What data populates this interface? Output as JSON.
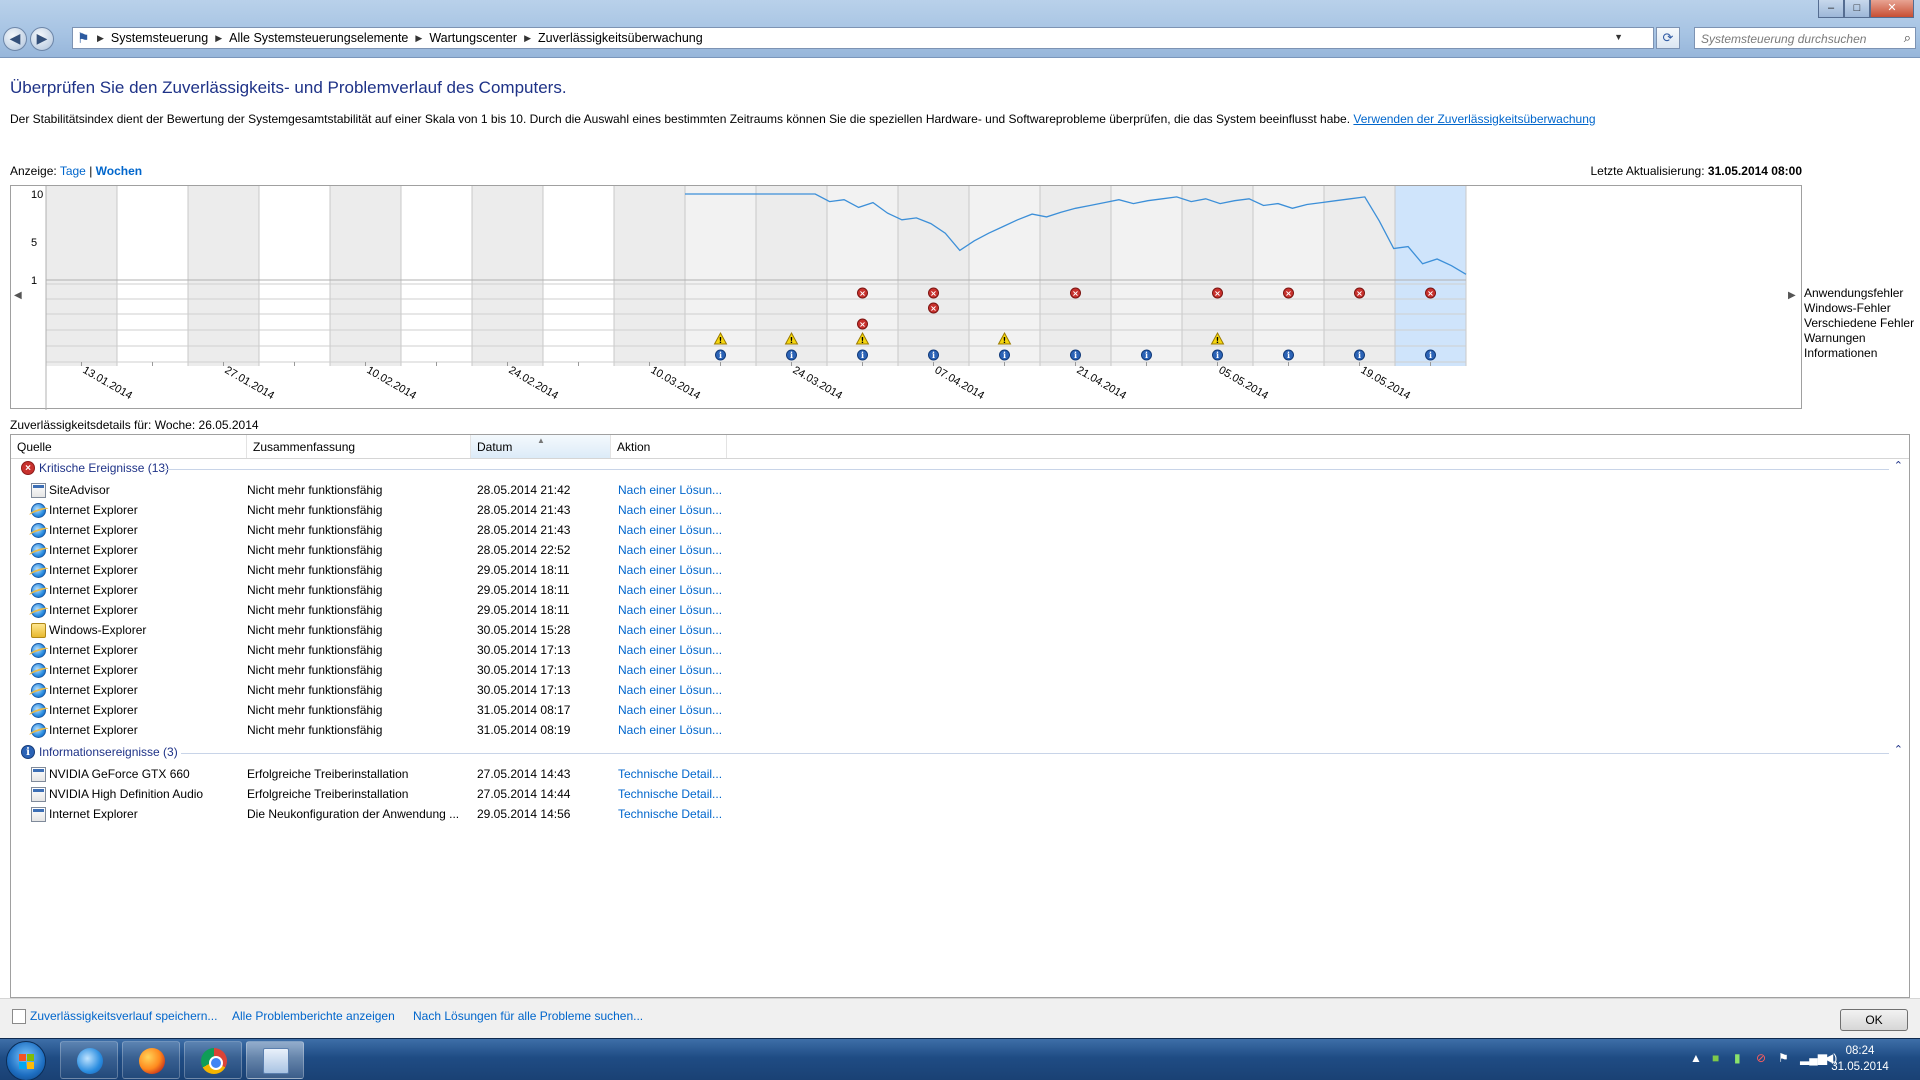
{
  "window": {
    "breadcrumb": [
      "Systemsteuerung",
      "Alle Systemsteuerungselemente",
      "Wartungscenter",
      "Zuverlässigkeitsüberwachung"
    ],
    "search_placeholder": "Systemsteuerung durchsuchen",
    "controls": {
      "minimize": "–",
      "maximize": "□",
      "close": "✕"
    }
  },
  "header": {
    "title": "Überprüfen Sie den Zuverlässigkeits- und Problemverlauf des Computers.",
    "intro": "Der Stabilitätsindex dient der Bewertung der Systemgesamtstabilität auf einer Skala von 1 bis 10. Durch die Auswahl eines bestimmten Zeitraums können Sie die speziellen Hardware- und Softwareprobleme überprüfen, die das System beeinflusst habe.",
    "intro_link": "Verwenden der Zuverlässigkeitsüberwachung",
    "view_label": "Anzeige:",
    "view_days": "Tage",
    "view_sep": "|",
    "view_weeks": "Wochen",
    "last_update_label": "Letzte Aktualisierung:",
    "last_update_value": "31.05.2014 08:00"
  },
  "chart_data": {
    "type": "line",
    "ylim": [
      1,
      10
    ],
    "yticks": [
      "10",
      "5",
      "1"
    ],
    "columns": 20,
    "selected_column": 19,
    "x_labels": [
      "13.01.2014",
      "27.01.2014",
      "10.02.2014",
      "24.02.2014",
      "10.03.2014",
      "24.03.2014",
      "07.04.2014",
      "21.04.2014",
      "05.05.2014",
      "19.05.2014"
    ],
    "stability_index": [
      10,
      10,
      10,
      10,
      10,
      10,
      10,
      10.0,
      10,
      10,
      9.2,
      9.4,
      8.6,
      9.1,
      8.0,
      7.3,
      7.5,
      6.9,
      5.9,
      4.1,
      5.1,
      5.9,
      6.6,
      7.3,
      7.9,
      7.6,
      8.1,
      8.5,
      8.8,
      9.1,
      9.4,
      9.0,
      9.3,
      9.5,
      9.7,
      9.2,
      9.5,
      9.0,
      9.3,
      9.5,
      8.8,
      9.0,
      8.5,
      8.9,
      9.1,
      9.3,
      9.5,
      9.7,
      7.2,
      4.3,
      4.5,
      2.7,
      3.2,
      2.5,
      1.6
    ],
    "legend": [
      "Anwendungsfehler",
      "Windows-Fehler",
      "Verschiedene Fehler",
      "Warnungen",
      "Informationen"
    ],
    "events": {
      "app_errors": [
        11,
        12,
        14,
        16,
        17,
        18,
        19
      ],
      "windows_errors": [
        12
      ],
      "misc_errors": [
        11
      ],
      "warnings": [
        9,
        10,
        11,
        13,
        16
      ],
      "informations": [
        9,
        10,
        11,
        12,
        13,
        14,
        15,
        16,
        17,
        18,
        19
      ]
    }
  },
  "details": {
    "label": "Zuverlässigkeitsdetails für: Woche: 26.05.2014",
    "columns": [
      "Quelle",
      "Zusammenfassung",
      "Datum",
      "Aktion"
    ],
    "groups": [
      {
        "title": "Kritische Ereignisse (13)",
        "icon": "error-icon",
        "rows": [
          {
            "icon": "window-icon",
            "source": "SiteAdvisor",
            "summary": "Nicht mehr funktionsfähig",
            "date": "28.05.2014 21:42",
            "action": "Nach einer Lösun..."
          },
          {
            "icon": "ie-icon",
            "source": "Internet Explorer",
            "summary": "Nicht mehr funktionsfähig",
            "date": "28.05.2014 21:43",
            "action": "Nach einer Lösun..."
          },
          {
            "icon": "ie-icon",
            "source": "Internet Explorer",
            "summary": "Nicht mehr funktionsfähig",
            "date": "28.05.2014 21:43",
            "action": "Nach einer Lösun..."
          },
          {
            "icon": "ie-icon",
            "source": "Internet Explorer",
            "summary": "Nicht mehr funktionsfähig",
            "date": "28.05.2014 22:52",
            "action": "Nach einer Lösun..."
          },
          {
            "icon": "ie-icon",
            "source": "Internet Explorer",
            "summary": "Nicht mehr funktionsfähig",
            "date": "29.05.2014 18:11",
            "action": "Nach einer Lösun..."
          },
          {
            "icon": "ie-icon",
            "source": "Internet Explorer",
            "summary": "Nicht mehr funktionsfähig",
            "date": "29.05.2014 18:11",
            "action": "Nach einer Lösun..."
          },
          {
            "icon": "ie-icon",
            "source": "Internet Explorer",
            "summary": "Nicht mehr funktionsfähig",
            "date": "29.05.2014 18:11",
            "action": "Nach einer Lösun..."
          },
          {
            "icon": "folder-icon",
            "source": "Windows-Explorer",
            "summary": "Nicht mehr funktionsfähig",
            "date": "30.05.2014 15:28",
            "action": "Nach einer Lösun..."
          },
          {
            "icon": "ie-icon",
            "source": "Internet Explorer",
            "summary": "Nicht mehr funktionsfähig",
            "date": "30.05.2014 17:13",
            "action": "Nach einer Lösun..."
          },
          {
            "icon": "ie-icon",
            "source": "Internet Explorer",
            "summary": "Nicht mehr funktionsfähig",
            "date": "30.05.2014 17:13",
            "action": "Nach einer Lösun..."
          },
          {
            "icon": "ie-icon",
            "source": "Internet Explorer",
            "summary": "Nicht mehr funktionsfähig",
            "date": "30.05.2014 17:13",
            "action": "Nach einer Lösun..."
          },
          {
            "icon": "ie-icon",
            "source": "Internet Explorer",
            "summary": "Nicht mehr funktionsfähig",
            "date": "31.05.2014 08:17",
            "action": "Nach einer Lösun..."
          },
          {
            "icon": "ie-icon",
            "source": "Internet Explorer",
            "summary": "Nicht mehr funktionsfähig",
            "date": "31.05.2014 08:19",
            "action": "Nach einer Lösun..."
          }
        ]
      },
      {
        "title": "Informationsereignisse (3)",
        "icon": "info-icon",
        "rows": [
          {
            "icon": "window-icon",
            "source": "NVIDIA GeForce GTX 660",
            "summary": "Erfolgreiche Treiberinstallation",
            "date": "27.05.2014 14:43",
            "action": "Technische Detail..."
          },
          {
            "icon": "window-icon",
            "source": "NVIDIA High Definition Audio",
            "summary": "Erfolgreiche Treiberinstallation",
            "date": "27.05.2014 14:44",
            "action": "Technische Detail..."
          },
          {
            "icon": "window-icon",
            "source": "Internet Explorer",
            "summary": "Die Neukonfiguration der Anwendung ...",
            "date": "29.05.2014 14:56",
            "action": "Technische Detail..."
          }
        ]
      }
    ]
  },
  "footer": {
    "save_history": "Zuverlässigkeitsverlauf speichern...",
    "all_reports": "Alle Problemberichte anzeigen",
    "check_all": "Nach Lösungen für alle Probleme suchen...",
    "ok": "OK"
  },
  "taskbar": {
    "time": "08:24",
    "date": "31.05.2014"
  }
}
